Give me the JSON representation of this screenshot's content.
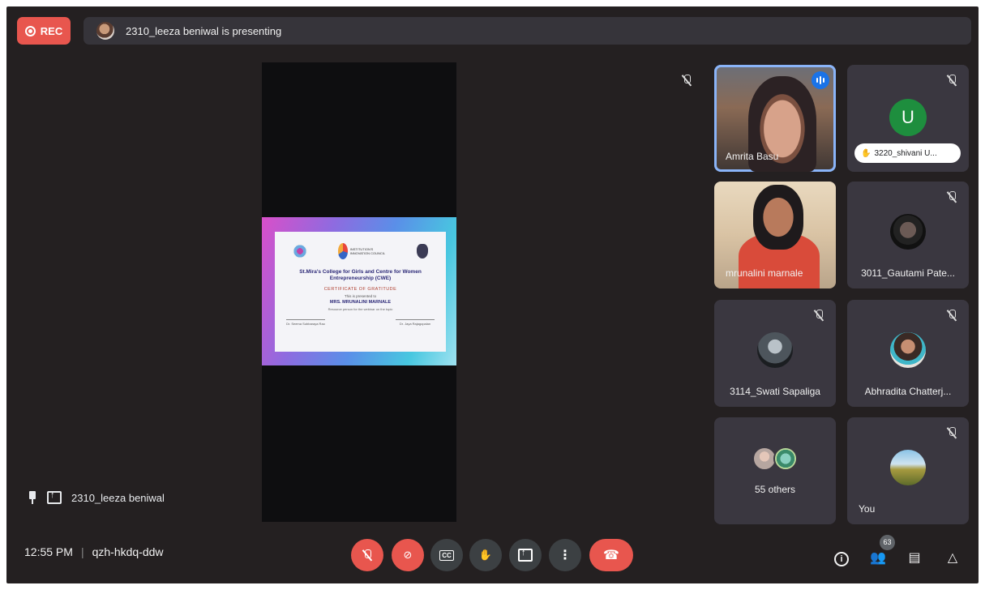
{
  "top": {
    "rec_label": "REC",
    "presenting_text": "2310_leeza beniwal is presenting"
  },
  "presentation": {
    "presenter_name": "2310_leeza beniwal",
    "certificate": {
      "logo_text": "INSTITUTION'S INNOVATION COUNCIL",
      "title": "St.Mira's College for Girls and Centre for Women Entrepreneurship (CWE)",
      "subtitle": "CERTIFICATE OF GRATITUDE",
      "presented_to": "This is presented to",
      "name": "MRS. MRUNALINI MARNALE",
      "body": "Resource person for the webinar on the topic",
      "signer_left": "Dr. Seema Subbaraya Rao",
      "signer_right": "Dr. Jaya Rajagopalan"
    }
  },
  "participants": [
    {
      "name": "Amrita Basu",
      "speaking": true
    },
    {
      "name": "3220_shivani U...",
      "initial": "U",
      "hand_raised": true
    },
    {
      "name": "mrunalini marnale"
    },
    {
      "name": "3011_Gautami Pate..."
    },
    {
      "name": "3114_Swati Sapaliga"
    },
    {
      "name": "Abhradita Chatterj..."
    },
    {
      "name": "55 others"
    },
    {
      "name": "You"
    }
  ],
  "bottom": {
    "time": "12:55 PM",
    "separator": "|",
    "meeting_code": "qzh-hkdq-ddw",
    "people_count": "63",
    "cc_label": "CC"
  },
  "colors": {
    "background": "#242021",
    "tile": "#3a3740",
    "accent_red": "#e8564e",
    "active_outline": "#8ab4f8"
  }
}
